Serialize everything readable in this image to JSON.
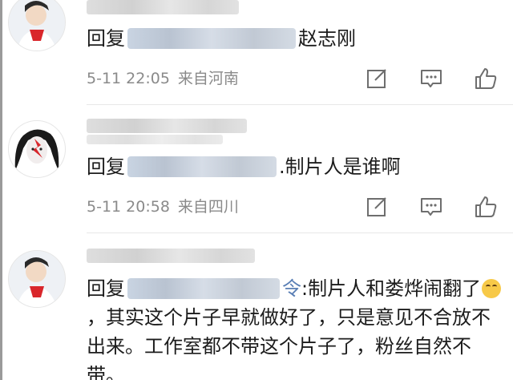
{
  "comments": [
    {
      "reply_prefix": "回复",
      "reply_body": "赵志刚",
      "date": "5-11 22:05",
      "location": "来自河南"
    },
    {
      "reply_prefix": "回复",
      "reply_body": ".制片人是谁啊",
      "date": "5-11 20:58",
      "location": "来自四川"
    },
    {
      "reply_prefix": "回复",
      "reply_mid": "令",
      "reply_body": ":制片人和娄烨闹翻了",
      "reply_body_2": "，其实这个片子早就做好了，只是意见不合放不出来。工作室都不带这个片子了，粉丝自然不带。"
    }
  ],
  "icons": {
    "share": "share-edit-icon",
    "comment": "comment-bubble-icon",
    "like": "thumbs-up-icon"
  },
  "colors": {
    "text": "#1c1c1c",
    "meta": "#8a8a8a",
    "icon": "#6e6e6e"
  }
}
